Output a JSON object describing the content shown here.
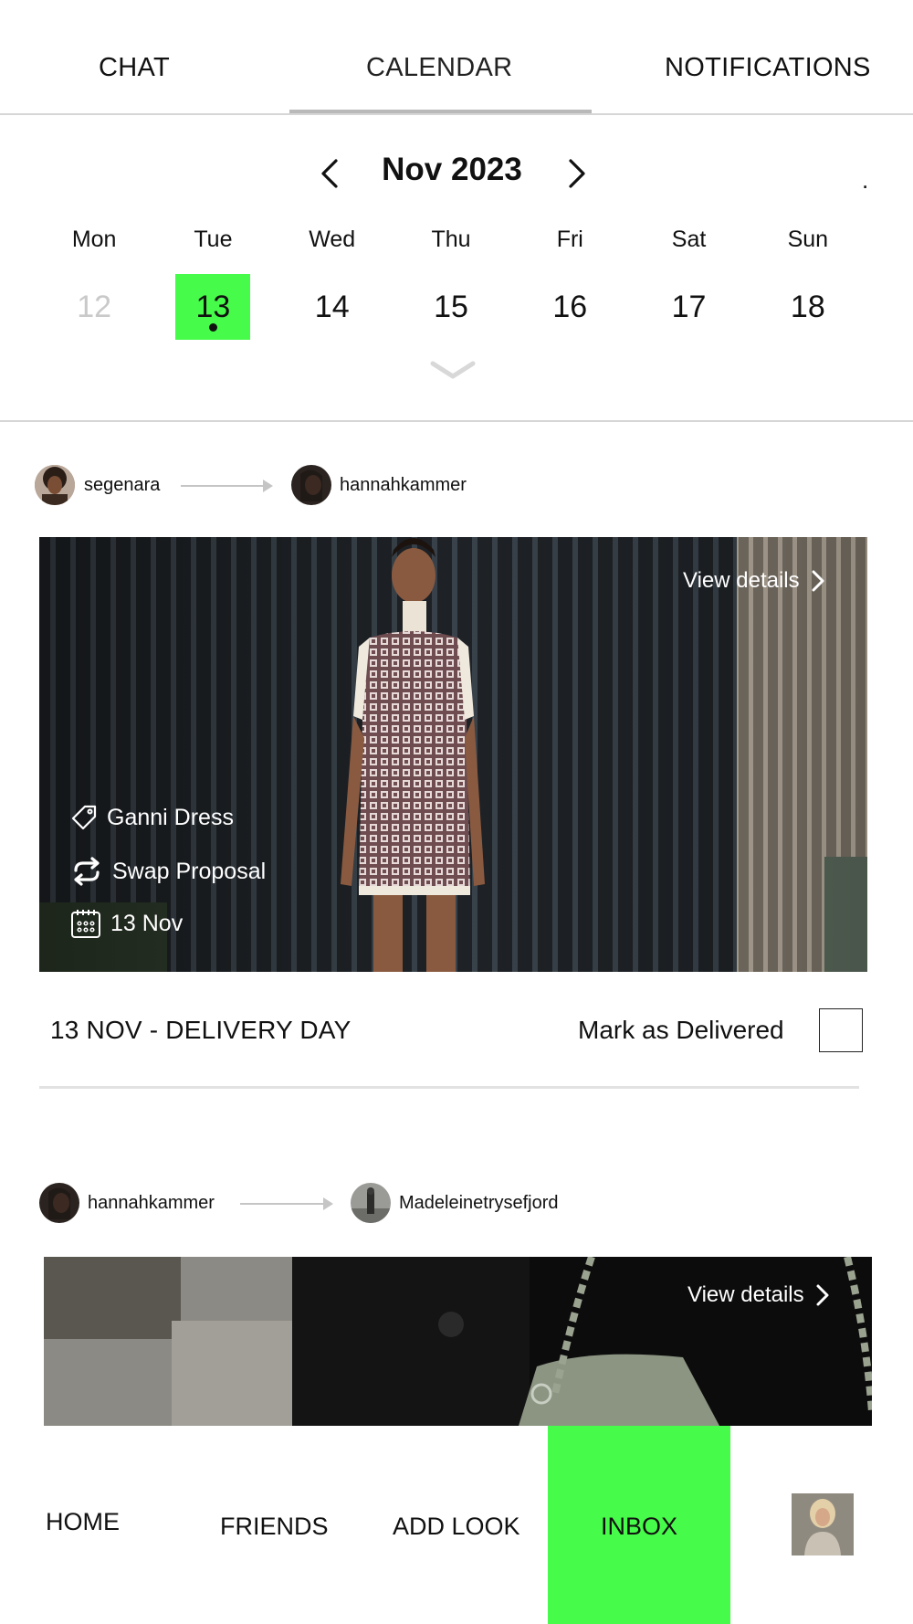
{
  "tabs": {
    "chat": "CHAT",
    "calendar": "CALENDAR",
    "notifications": "NOTIFICATIONS",
    "active": "calendar"
  },
  "calendar": {
    "month_label": "Nov 2023",
    "trailing_mark": ".",
    "weekdays": [
      "Mon",
      "Tue",
      "Wed",
      "Thu",
      "Fri",
      "Sat",
      "Sun"
    ],
    "days": [
      "12",
      "13",
      "14",
      "15",
      "16",
      "17",
      "18"
    ],
    "selected_day": "13",
    "accent_color": "#47fb4a"
  },
  "swap1": {
    "from_user": "segenara",
    "to_user": "hannahkammer",
    "view_details": "View details",
    "item_name": "Ganni Dress",
    "type": "Swap Proposal",
    "date": "13 Nov",
    "delivery_title": "13 NOV - DELIVERY DAY",
    "mark_label": "Mark as Delivered"
  },
  "swap2": {
    "from_user": "hannahkammer",
    "to_user": "Madeleinetrysefjord",
    "view_details": "View details"
  },
  "bottom_nav": {
    "home": "HOME",
    "friends": "FRIENDS",
    "add_look": "ADD LOOK",
    "inbox": "INBOX",
    "active": "inbox"
  }
}
